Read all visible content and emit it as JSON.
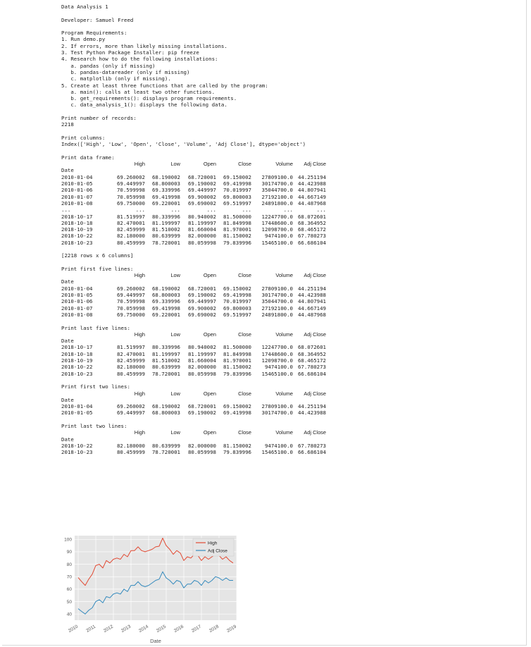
{
  "header": {
    "title": "Data Analysis 1",
    "developer": "Developer: Samuel Freed"
  },
  "requirements": [
    "Program Requirements:",
    "1. Run demo.py",
    "2. If errors, more than likely missing installations.",
    "3. Test Python Package Installer: pip freeze",
    "4. Research how to do the following installations:",
    "   a. pandas (only if missing)",
    "   b. pandas-datareader (only if missing)",
    "   c. matplotlib (only if missing).",
    "5. Create at least three functions that are called by the program:",
    "   a. main(): calls at least two other functions.",
    "   b. get_requirements(): displays program requirements.",
    "   c. data_analysis_1(): displays the following data."
  ],
  "records": {
    "label": "Print number of records:",
    "value": "2218"
  },
  "columns": {
    "label": "Print columns:",
    "value": "Index(['High', 'Low', 'Open', 'Close', 'Volume', 'Adj Close'], dtype='object')"
  },
  "table_headers": [
    "High",
    "Low",
    "Open",
    "Close",
    "Volume",
    "Adj Close"
  ],
  "index_name": "Date",
  "rows": {
    "r0104": [
      "2010-01-04",
      "69.260002",
      "68.190002",
      "68.720001",
      "69.150002",
      "27809100.0",
      "44.251194"
    ],
    "r0105": [
      "2010-01-05",
      "69.449997",
      "68.800003",
      "69.190002",
      "69.419998",
      "30174700.0",
      "44.423988"
    ],
    "r0106": [
      "2010-01-06",
      "70.599998",
      "69.339996",
      "69.449997",
      "70.019997",
      "35044700.0",
      "44.807941"
    ],
    "r0107": [
      "2010-01-07",
      "70.059998",
      "69.419998",
      "69.900002",
      "69.800003",
      "27192100.0",
      "44.667149"
    ],
    "r0108": [
      "2010-01-08",
      "69.750000",
      "69.220001",
      "69.690002",
      "69.519997",
      "24891800.0",
      "44.487968"
    ],
    "r1017": [
      "2018-10-17",
      "81.519997",
      "80.339996",
      "80.940002",
      "81.500000",
      "12247700.0",
      "68.072601"
    ],
    "r1018": [
      "2018-10-18",
      "82.470001",
      "81.199997",
      "81.199997",
      "81.849998",
      "17448600.0",
      "68.364952"
    ],
    "r1019": [
      "2018-10-19",
      "82.459999",
      "81.510002",
      "81.660004",
      "81.970001",
      "12098700.0",
      "68.465172"
    ],
    "r1022": [
      "2018-10-22",
      "82.180000",
      "80.639999",
      "82.000000",
      "81.150002",
      "9474100.0",
      "67.780273"
    ],
    "r1023": [
      "2018-10-23",
      "80.459999",
      "78.720001",
      "80.059998",
      "79.839996",
      "15465100.0",
      "66.686104"
    ]
  },
  "ellipsis": "...",
  "sections": {
    "frame": "Print data frame:",
    "shape": "[2218 rows x 6 columns]",
    "first5": "Print first five lines:",
    "last5": "Print last five lines:",
    "first2": "Print first two lines:",
    "last2": "Print last two lines:"
  },
  "chart_data": {
    "type": "line",
    "title": "",
    "xlabel": "Date",
    "ylabel": "",
    "x_ticks": [
      "2010",
      "2011",
      "2012",
      "2013",
      "2014",
      "2015",
      "2016",
      "2017",
      "2018",
      "2019"
    ],
    "y_ticks": [
      40,
      50,
      60,
      70,
      80,
      90,
      100
    ],
    "ylim": [
      35,
      103
    ],
    "xlim": [
      2009.8,
      2019.0
    ],
    "grid": true,
    "legend": "top-right",
    "series": [
      {
        "name": "High",
        "color": "#e24a33",
        "x": [
          2010.0,
          2010.2,
          2010.4,
          2010.6,
          2010.8,
          2011.0,
          2011.2,
          2011.4,
          2011.6,
          2011.8,
          2012.0,
          2012.2,
          2012.4,
          2012.6,
          2012.8,
          2013.0,
          2013.2,
          2013.4,
          2013.6,
          2013.8,
          2014.0,
          2014.2,
          2014.4,
          2014.6,
          2014.8,
          2015.0,
          2015.2,
          2015.4,
          2015.6,
          2015.8,
          2016.0,
          2016.2,
          2016.4,
          2016.6,
          2016.8,
          2017.0,
          2017.2,
          2017.4,
          2017.6,
          2017.8,
          2018.0,
          2018.2,
          2018.4,
          2018.6,
          2018.8
        ],
        "values": [
          69.3,
          66.0,
          63.0,
          68.0,
          72.0,
          79.0,
          80.0,
          77.0,
          83.0,
          81.0,
          84.0,
          85.0,
          84.0,
          88.0,
          86.0,
          91.0,
          91.0,
          94.0,
          91.0,
          90.0,
          91.0,
          92.0,
          94.0,
          94.5,
          101.0,
          95.0,
          92.0,
          88.0,
          91.0,
          89.0,
          83.0,
          86.0,
          85.0,
          88.0,
          87.0,
          83.0,
          86.0,
          84.0,
          86.0,
          88.0,
          87.0,
          84.0,
          86.0,
          83.0,
          81.0
        ]
      },
      {
        "name": "Adj Close",
        "color": "#348abd",
        "x": [
          2010.0,
          2010.2,
          2010.4,
          2010.6,
          2010.8,
          2011.0,
          2011.2,
          2011.4,
          2011.6,
          2011.8,
          2012.0,
          2012.2,
          2012.4,
          2012.6,
          2012.8,
          2013.0,
          2013.2,
          2013.4,
          2013.6,
          2013.8,
          2014.0,
          2014.2,
          2014.4,
          2014.6,
          2014.8,
          2015.0,
          2015.2,
          2015.4,
          2015.6,
          2015.8,
          2016.0,
          2016.2,
          2016.4,
          2016.6,
          2016.8,
          2017.0,
          2017.2,
          2017.4,
          2017.6,
          2017.8,
          2018.0,
          2018.2,
          2018.4,
          2018.6,
          2018.8
        ],
        "values": [
          44.3,
          42.0,
          40.0,
          43.0,
          45.0,
          50.0,
          51.5,
          49.0,
          54.0,
          53.0,
          56.0,
          57.0,
          56.0,
          60.0,
          58.0,
          63.0,
          63.0,
          66.0,
          63.0,
          62.0,
          63.0,
          65.0,
          67.0,
          68.0,
          74.0,
          69.0,
          67.0,
          64.0,
          67.0,
          66.0,
          61.0,
          64.0,
          64.0,
          67.0,
          66.0,
          63.0,
          67.0,
          65.0,
          67.0,
          70.0,
          69.0,
          67.0,
          69.0,
          67.0,
          67.0
        ]
      }
    ]
  }
}
